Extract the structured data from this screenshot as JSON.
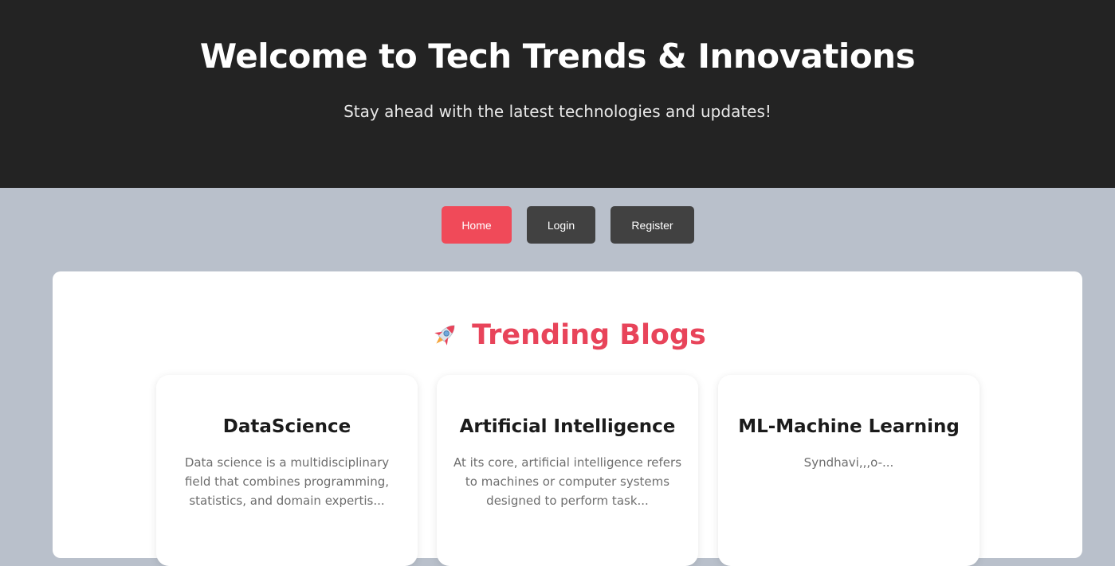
{
  "hero": {
    "title": "Welcome to Tech Trends & Innovations",
    "subtitle": "Stay ahead with the latest technologies and updates!"
  },
  "nav": {
    "home": "Home",
    "login": "Login",
    "register": "Register",
    "active": "Home",
    "colors": {
      "active": "#f04a59",
      "inactive": "#414141"
    }
  },
  "section": {
    "icon": "rocket-icon",
    "title": "Trending Blogs",
    "title_color": "#e8445a"
  },
  "blogs": [
    {
      "title": "DataScience",
      "excerpt": "Data science is a multidisciplinary field that combines programming, statistics, and domain expertis..."
    },
    {
      "title": "Artificial Intelligence",
      "excerpt": "At its core, artificial intelligence refers to machines or computer systems designed to perform task..."
    },
    {
      "title": "ML-Machine Learning",
      "excerpt": "Syndhavi,,,o-..."
    }
  ]
}
